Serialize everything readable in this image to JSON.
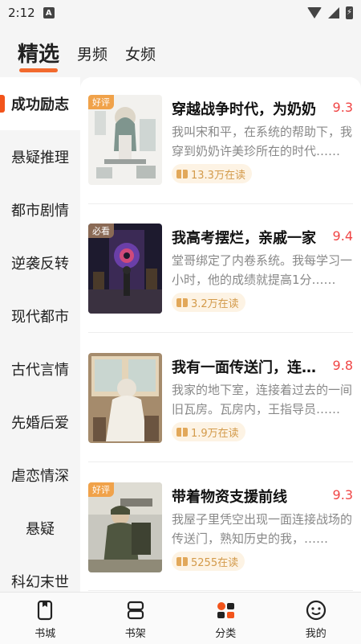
{
  "status_bar": {
    "time": "2:12",
    "notification_letter": "A"
  },
  "top_tabs": [
    {
      "label": "精选",
      "active": true
    },
    {
      "label": "男频",
      "active": false
    },
    {
      "label": "女频",
      "active": false
    }
  ],
  "sidebar": {
    "items": [
      {
        "label": "成功励志",
        "active": true
      },
      {
        "label": "悬疑推理"
      },
      {
        "label": "都市剧情"
      },
      {
        "label": "逆袭反转"
      },
      {
        "label": "现代都市"
      },
      {
        "label": "古代言情"
      },
      {
        "label": "先婚后爱"
      },
      {
        "label": "虐恋情深"
      },
      {
        "label": "悬疑"
      },
      {
        "label": "科幻末世"
      }
    ]
  },
  "books": [
    {
      "badge": "好评",
      "title": "穿越战争时代，为奶奶",
      "score": "9.3",
      "desc": "我叫宋和平，在系统的帮助下，我穿到奶奶许美珍所在的时代……",
      "reading": "13.3万在读"
    },
    {
      "badge": "必看",
      "title": "我高考摆烂，亲戚一家",
      "score": "9.4",
      "desc": "堂哥绑定了内卷系统。我每学习一小时，他的成绩就提高1分……",
      "reading": "3.2万在读"
    },
    {
      "badge": "",
      "title": "我有一面传送门，连接过去",
      "score": "9.8",
      "desc": "我家的地下室，连接着过去的一间旧瓦房。瓦房内，王指导员……",
      "reading": "1.9万在读"
    },
    {
      "badge": "好评",
      "title": "带着物资支援前线",
      "score": "9.3",
      "desc": "我屋子里凭空出现一面连接战场的传送门，熟知历史的我，……",
      "reading": "5255在读"
    }
  ],
  "bottom_nav": [
    {
      "label": "书城",
      "icon": "bookstore-icon"
    },
    {
      "label": "书架",
      "icon": "bookshelf-icon"
    },
    {
      "label": "分类",
      "icon": "category-icon"
    },
    {
      "label": "我的",
      "icon": "profile-icon"
    }
  ],
  "colors": {
    "accent": "#f26a2e",
    "score": "#f04545",
    "badge_good": "#f0a24a",
    "badge_must": "#8a6a55"
  }
}
